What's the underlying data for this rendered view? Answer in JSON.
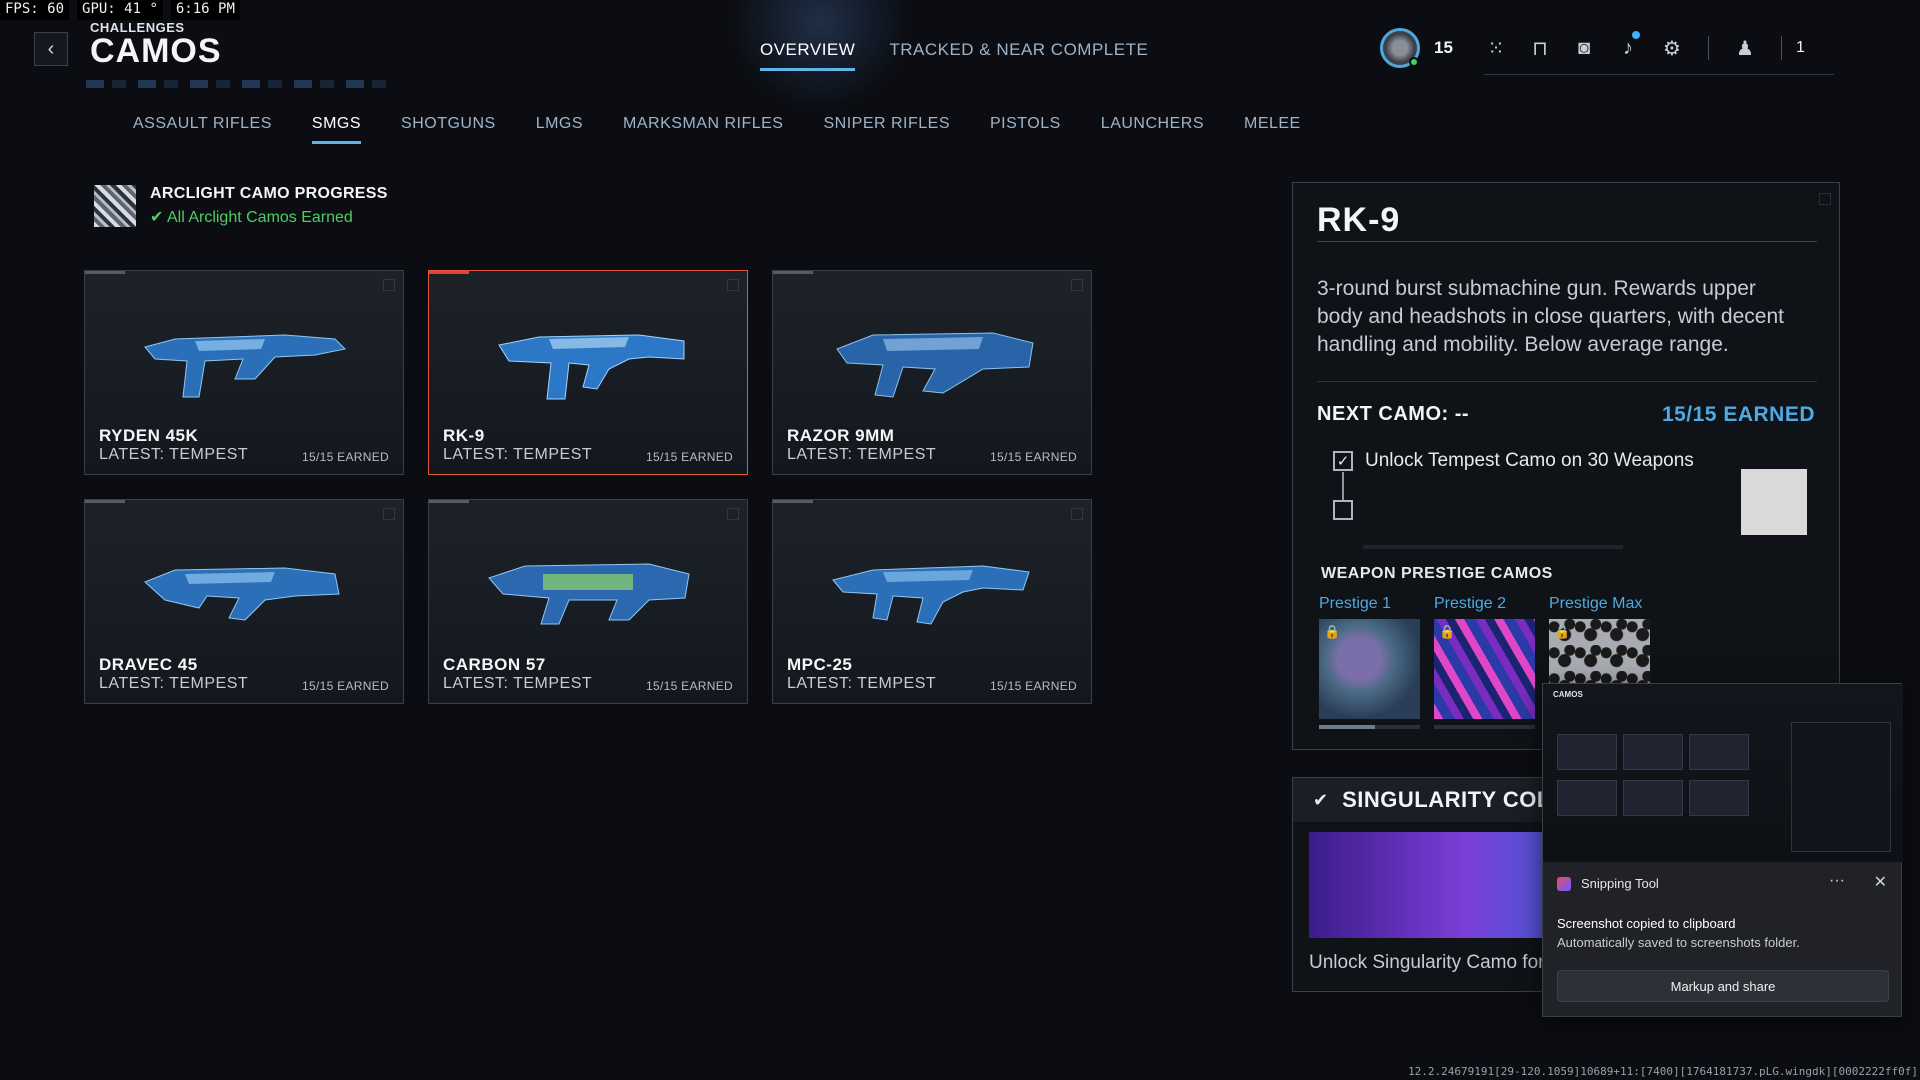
{
  "perf": {
    "fps": "FPS:  60",
    "gpu": "GPU: 41 °",
    "time": "6:16 PM"
  },
  "header": {
    "breadcrumb": "CHALLENGES",
    "title": "CAMOS",
    "back_icon": "chevron-left-icon"
  },
  "top_tabs": [
    {
      "label": "OVERVIEW",
      "active": true
    },
    {
      "label": "TRACKED & NEAR COMPLETE",
      "active": false
    }
  ],
  "hud": {
    "level": "15",
    "party_count": "1",
    "online_color": "#39d36b"
  },
  "categories": [
    {
      "label": "ASSAULT RIFLES"
    },
    {
      "label": "SMGS"
    },
    {
      "label": "SHOTGUNS"
    },
    {
      "label": "LMGS"
    },
    {
      "label": "MARKSMAN RIFLES"
    },
    {
      "label": "SNIPER RIFLES"
    },
    {
      "label": "PISTOLS"
    },
    {
      "label": "LAUNCHERS"
    },
    {
      "label": "MELEE"
    }
  ],
  "arclight": {
    "title": "ARCLIGHT CAMO PROGRESS",
    "status": "All Arclight Camos Earned",
    "status_color": "#4ccf5f"
  },
  "weapons": [
    {
      "name": "RYDEN 45K",
      "latest": "LATEST: TEMPEST",
      "earned": "15/15 EARNED",
      "selected": false
    },
    {
      "name": "RK-9",
      "latest": "LATEST: TEMPEST",
      "earned": "15/15 EARNED",
      "selected": true
    },
    {
      "name": "RAZOR 9MM",
      "latest": "LATEST: TEMPEST",
      "earned": "15/15 EARNED",
      "selected": false
    },
    {
      "name": "DRAVEC 45",
      "latest": "LATEST: TEMPEST",
      "earned": "15/15 EARNED",
      "selected": false
    },
    {
      "name": "CARBON 57",
      "latest": "LATEST: TEMPEST",
      "earned": "15/15 EARNED",
      "selected": false
    },
    {
      "name": "MPC-25",
      "latest": "LATEST: TEMPEST",
      "earned": "15/15 EARNED",
      "selected": false
    }
  ],
  "detail": {
    "title": "RK-9",
    "description": "3-round burst submachine gun. Rewards upper body and headshots in close quarters, with decent handling and mobility. Below average range.",
    "next_camo": "NEXT CAMO: --",
    "earned": "15/15 EARNED",
    "challenge": "Unlock Tempest Camo on 30 Weapons",
    "prestige_title": "WEAPON PRESTIGE CAMOS",
    "prestige": [
      {
        "label": "Prestige 1",
        "progress": 0.55
      },
      {
        "label": "Prestige 2",
        "progress": 0
      },
      {
        "label": "Prestige Max",
        "progress": 0
      }
    ]
  },
  "singularity": {
    "title": "SINGULARITY COLLE",
    "description": "Unlock Singularity Camo for any V"
  },
  "snip": {
    "app": "Snipping Tool",
    "message": "Screenshot copied to clipboard",
    "sub": "Automatically saved to screenshots folder.",
    "button": "Markup and share",
    "more": "···",
    "close": "✕",
    "thumb_title": "CAMOS"
  },
  "build": "12.2.24679191[29-120.1059]10689+11:[7400][1764181737.pLG.wingdk][0002222ff0f]",
  "colors": {
    "accent": "#5fb4e8",
    "selected_border": "#e25a3a",
    "earned_blue": "#4fa9e2"
  }
}
